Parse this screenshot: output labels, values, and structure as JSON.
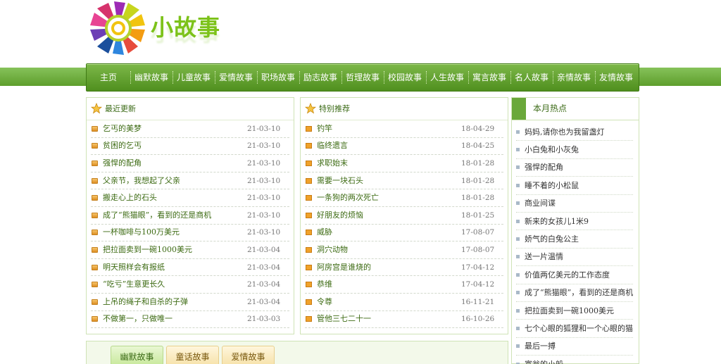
{
  "site": {
    "logo_text": "小故事"
  },
  "nav": {
    "home": "主页",
    "categories": [
      "幽默故事",
      "儿童故事",
      "爱情故事",
      "职场故事",
      "励志故事",
      "哲理故事",
      "校园故事",
      "人生故事",
      "寓言故事",
      "名人故事",
      "亲情故事",
      "友情故事"
    ]
  },
  "recent": {
    "title": "最近更新",
    "items": [
      {
        "title": "乞丐的美梦",
        "date": "21-03-10"
      },
      {
        "title": "贫困的乞丐",
        "date": "21-03-10"
      },
      {
        "title": "强悍的配角",
        "date": "21-03-10"
      },
      {
        "title": "父亲节，我想起了父亲",
        "date": "21-03-10"
      },
      {
        "title": "搬走心上的石头",
        "date": "21-03-10"
      },
      {
        "title": "成了“熊猫眼”，看到的还是商机",
        "date": "21-03-10"
      },
      {
        "title": "一杯咖啡与100万美元",
        "date": "21-03-10"
      },
      {
        "title": "把拉面卖到一碗1000美元",
        "date": "21-03-04"
      },
      {
        "title": "明天照样会有报纸",
        "date": "21-03-04"
      },
      {
        "title": "“吃亏”生意更长久",
        "date": "21-03-04"
      },
      {
        "title": "上吊的绳子和自杀的子弹",
        "date": "21-03-04"
      },
      {
        "title": "不做第一，只做唯一",
        "date": "21-03-03"
      }
    ]
  },
  "special": {
    "title": "特别推荐",
    "items": [
      {
        "title": "钓竿",
        "date": "18-04-29"
      },
      {
        "title": "临终遗言",
        "date": "18-04-25"
      },
      {
        "title": "求职始末",
        "date": "18-01-28"
      },
      {
        "title": "需要一块石头",
        "date": "18-01-28"
      },
      {
        "title": "一条狗的两次死亡",
        "date": "18-01-28"
      },
      {
        "title": "好朋友的烦恼",
        "date": "18-01-25"
      },
      {
        "title": "威胁",
        "date": "17-08-07"
      },
      {
        "title": "洞穴动物",
        "date": "17-08-07"
      },
      {
        "title": "阿房宫是谁烧的",
        "date": "17-04-12"
      },
      {
        "title": "恭维",
        "date": "17-04-12"
      },
      {
        "title": "令尊",
        "date": "16-11-21"
      },
      {
        "title": "管他三七二十一",
        "date": "16-10-26"
      }
    ]
  },
  "hot": {
    "title": "本月热点",
    "items": [
      "妈妈,请你也为我留盏灯",
      "小白兔和小灰兔",
      "强悍的配角",
      "睡不着的小松鼠",
      "商业间谍",
      "新来的女孩儿1米9",
      "娇气的白兔公主",
      "送一片温情",
      "价值两亿美元的工作态度",
      "成了“熊猫眼”，看到的还是商机",
      "把拉面卖到一碗1000美元",
      "七个心眼的狐狸和一个心眼的猫头",
      "最后一搏",
      "富翁的小船"
    ]
  },
  "tabs": [
    "幽默故事",
    "童话故事",
    "爱情故事"
  ],
  "colors": {
    "nav_green": "#5e9e2c",
    "link_green": "#3d6b13",
    "accent_orange": "#f0a22a"
  }
}
